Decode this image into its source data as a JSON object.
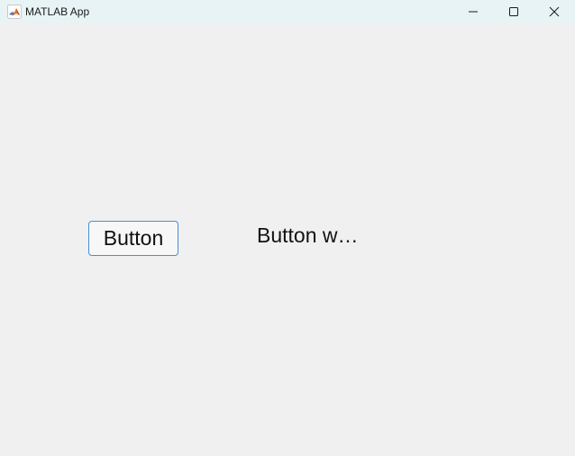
{
  "window": {
    "title": "MATLAB App",
    "icon": "matlab-icon",
    "controls": [
      "minimize-icon",
      "maximize-icon",
      "close-icon"
    ]
  },
  "content": {
    "button_label": "Button",
    "label_text": "Button w…"
  },
  "colors": {
    "titlebar_bg": "#e8f3f5",
    "content_bg": "#f0f0f0",
    "button_border": "#4a8fd4"
  }
}
